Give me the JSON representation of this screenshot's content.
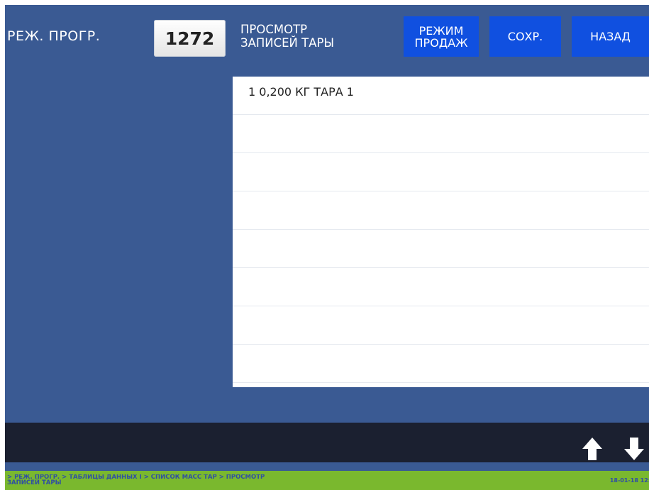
{
  "header": {
    "mode_label": "РЕЖ. ПРОГР.",
    "program_number": "1272",
    "title_line1": "ПРОСМОТР",
    "title_line2": "ЗАПИСЕЙ ТАРЫ"
  },
  "buttons": {
    "sales_mode_line1": "РЕЖИМ",
    "sales_mode_line2": "ПРОДАЖ",
    "save": "СОХР.",
    "back": "НАЗАД"
  },
  "list": {
    "rows": [
      "1  0,200 КГ ТАРА 1",
      "",
      "",
      "",
      "",
      "",
      "",
      ""
    ]
  },
  "nav": {
    "up_icon": "arrow-up-icon",
    "down_icon": "arrow-down-icon"
  },
  "status": {
    "breadcrumb_line1": "> РЕЖ. ПРОГР. > ТАБЛИЦЫ ДАННЫХ I > СПИСОК МАСС ТАР > ПРОСМОТР",
    "breadcrumb_line2": "ЗАПИСЕЙ ТАРЫ",
    "datetime": "18-01-18 12:"
  },
  "colors": {
    "background": "#3a5a93",
    "button": "#1050e0",
    "nav_bar": "#1b2030",
    "status_bar": "#7ab82e",
    "status_text": "#2f4fa2"
  }
}
